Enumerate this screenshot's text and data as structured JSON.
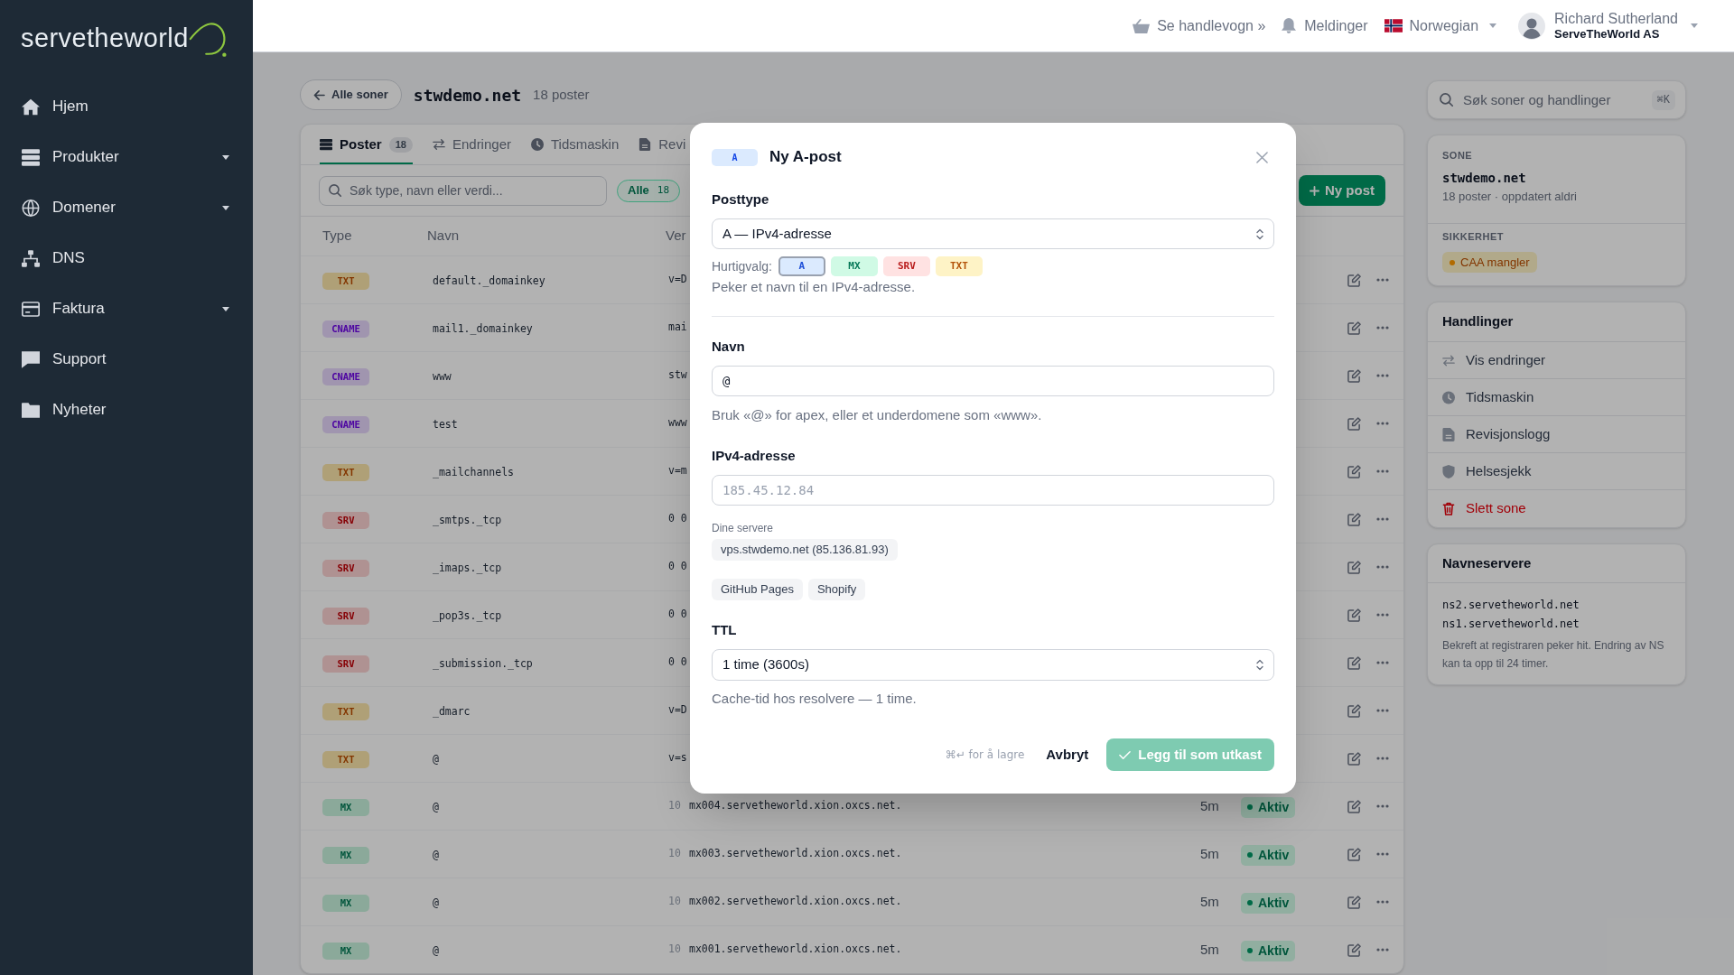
{
  "sidebar": {
    "logo": "servetheworld",
    "items": [
      {
        "label": "Hjem",
        "submenu": false
      },
      {
        "label": "Produkter",
        "submenu": true
      },
      {
        "label": "Domener",
        "submenu": true
      },
      {
        "label": "DNS",
        "submenu": false
      },
      {
        "label": "Faktura",
        "submenu": true
      },
      {
        "label": "Support",
        "submenu": false
      },
      {
        "label": "Nyheter",
        "submenu": false
      }
    ]
  },
  "top_bar": {
    "cart": "Se handlevogn »",
    "notifications": "Meldinger",
    "language": "Norwegian",
    "user": {
      "name": "Richard Sutherland",
      "company": "ServeTheWorld AS"
    }
  },
  "page": {
    "back": "Alle soner",
    "zone": "stwdemo.net",
    "record_count": "18 poster"
  },
  "tabs": [
    {
      "label": "Poster",
      "count": "18",
      "selected": true
    },
    {
      "label": "Endringer",
      "selected": false
    },
    {
      "label": "Tidsmaskin",
      "selected": false
    },
    {
      "label": "Revi",
      "selected": false
    }
  ],
  "toolbar": {
    "search": {
      "placeholder": "Søk type, navn eller verdi..."
    },
    "filters": [
      {
        "label": "Alle",
        "count": "18",
        "selected": true
      }
    ],
    "new_button": "Ny post"
  },
  "table": {
    "columns": [
      "Type",
      "Navn",
      "Ver"
    ],
    "records": [
      {
        "type": "TXT",
        "color": "#b0a078",
        "name": "default._domainkey",
        "value": "v=D"
      },
      {
        "type": "CNAME",
        "color": "#a096b0",
        "name": "mail1._domainkey",
        "value": "mai"
      },
      {
        "type": "CNAME",
        "color": "#a096b0",
        "name": "www",
        "value": "stw"
      },
      {
        "type": "CNAME",
        "color": "#a096b0",
        "name": "test",
        "value": "www"
      },
      {
        "type": "TXT",
        "color": "#b0a078",
        "name": "_mailchannels",
        "value": "v=m"
      },
      {
        "type": "SRV",
        "color": "#b09292",
        "name": "_smtps._tcp",
        "value": "0 0"
      },
      {
        "type": "SRV",
        "color": "#b09292",
        "name": "_imaps._tcp",
        "value": "0 0"
      },
      {
        "type": "SRV",
        "color": "#b09292",
        "name": "_pop3s._tcp",
        "value": "0 0"
      },
      {
        "type": "SRV",
        "color": "#b09292",
        "name": "_submission._tcp",
        "value": "0 0"
      },
      {
        "type": "TXT",
        "color": "#b0a078",
        "name": "_dmarc",
        "value": "v=D"
      },
      {
        "type": "TXT",
        "color": "#b0a078",
        "name": "@",
        "value": "v=s"
      },
      {
        "type": "MX",
        "color": "#8caa9b",
        "name": "@",
        "priority": "10",
        "value": "mx004.servetheworld.xion.oxcs.net.",
        "ttl": "5m",
        "status": "Aktiv"
      },
      {
        "type": "MX",
        "color": "#8caa9b",
        "name": "@",
        "priority": "10",
        "value": "mx003.servetheworld.xion.oxcs.net.",
        "ttl": "5m",
        "status": "Aktiv"
      },
      {
        "type": "MX",
        "color": "#8caa9b",
        "name": "@",
        "priority": "10",
        "value": "mx002.servetheworld.xion.oxcs.net.",
        "ttl": "5m",
        "status": "Aktiv"
      },
      {
        "type": "MX",
        "color": "#8caa9b",
        "name": "@",
        "priority": "10",
        "value": "mx001.servetheworld.xion.oxcs.net.",
        "ttl": "5m",
        "status": "Aktiv"
      }
    ]
  },
  "modal": {
    "badge": "A",
    "title": "Ny A-post",
    "record_type": {
      "label": "Posttype",
      "value": "A — IPv4-adresse",
      "quick_label": "Hurtigvalg:",
      "quick_picks": [
        {
          "label": "A",
          "color": "#1d4ed8",
          "selected": true
        },
        {
          "label": "MX",
          "color": "#047857",
          "selected": false
        },
        {
          "label": "SRV",
          "color": "#b91c1c",
          "selected": false
        },
        {
          "label": "TXT",
          "color": "#b45309",
          "selected": false
        }
      ],
      "help": "Peker et navn til en IPv4-adresse."
    },
    "name": {
      "label": "Navn",
      "value": "@",
      "help": "Bruk «@» for apex, eller et underdomene som «www»."
    },
    "address": {
      "label": "IPv4-adresse",
      "placeholder": "185.45.12.84",
      "servers_label": "Dine servere",
      "servers": [
        "vps.stwdemo.net (85.136.81.93)"
      ],
      "presets": [
        "GitHub Pages",
        "Shopify"
      ]
    },
    "ttl": {
      "label": "TTL",
      "value": "1 time (3600s)",
      "help": "Cache-tid hos resolvere — 1 time."
    },
    "footer": {
      "hint": "⌘↵ for å lagre",
      "cancel": "Avbryt",
      "submit": "Legg til som utkast",
      "submit_disabled": true
    }
  },
  "side_panel": {
    "search": {
      "placeholder": "Søk soner og handlinger",
      "shortcut": "⌘K"
    },
    "zone": {
      "label": "SONE",
      "name": "stwdemo.net",
      "meta": "18 poster · oppdatert aldri",
      "security_label": "SIKKERHET",
      "warnings": [
        "CAA mangler"
      ]
    },
    "actions": {
      "title": "Handlinger",
      "items": [
        {
          "label": "Vis endringer",
          "danger": false
        },
        {
          "label": "Tidsmaskin",
          "danger": false
        },
        {
          "label": "Revisjonslogg",
          "danger": false
        },
        {
          "label": "Helsesjekk",
          "danger": false
        },
        {
          "label": "Slett sone",
          "danger": true
        }
      ]
    },
    "nameservers": {
      "title": "Navneservere",
      "servers": [
        "ns2.servetheworld.net",
        "ns1.servetheworld.net"
      ],
      "note": "Bekreft at registraren peker hit. Endring av NS kan ta opp til 24 timer."
    }
  }
}
